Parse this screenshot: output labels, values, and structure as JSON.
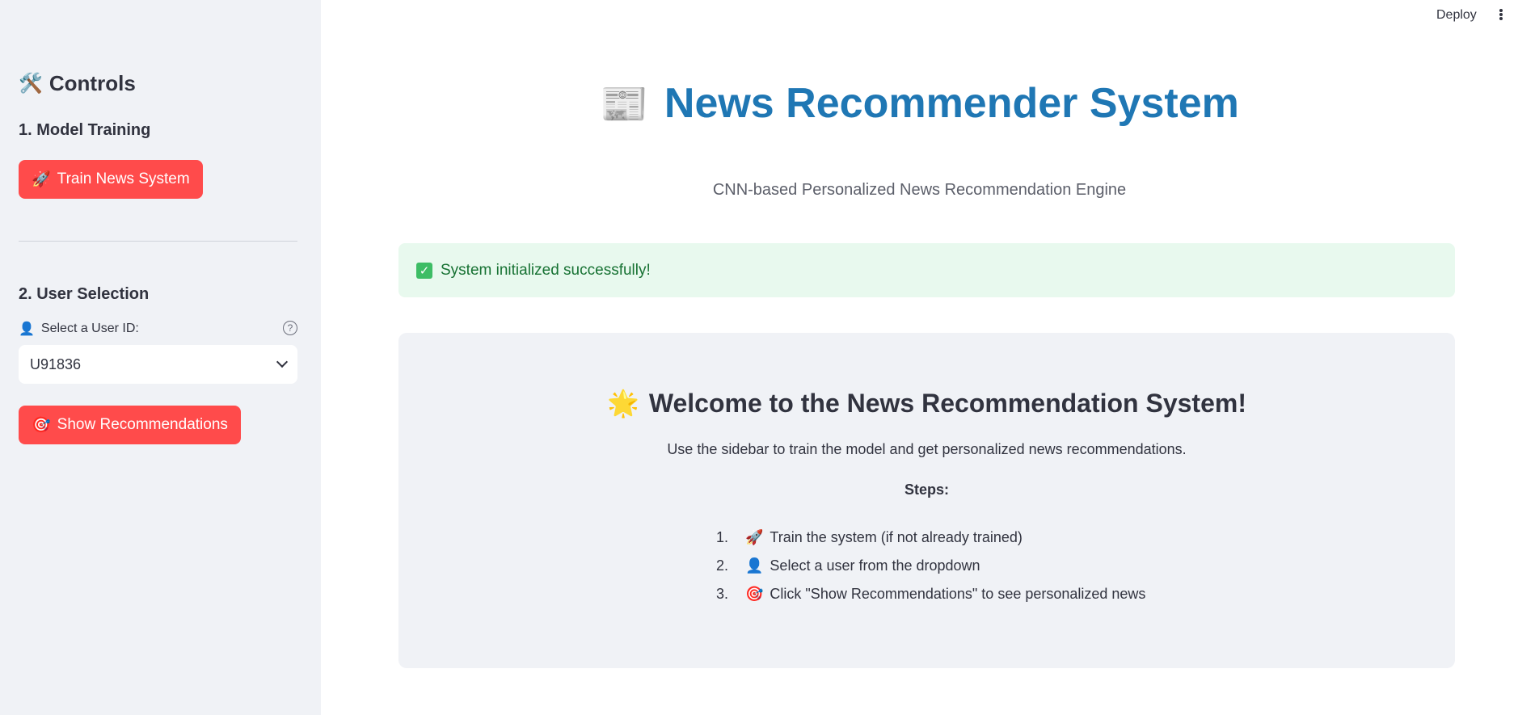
{
  "sidebar": {
    "title": "Controls",
    "title_icon": "🛠️",
    "model_training": {
      "heading": "1. Model Training",
      "button_icon": "🚀",
      "button_label": "Train News System"
    },
    "user_selection": {
      "heading": "2. User Selection",
      "select_icon": "👤",
      "select_label": "Select a User ID:",
      "help_glyph": "?",
      "selected_value": "U91836",
      "button_icon": "🎯",
      "button_label": "Show Recommendations"
    }
  },
  "topbar": {
    "deploy_label": "Deploy"
  },
  "main": {
    "title_icon": "📰",
    "title": "News Recommender System",
    "subtitle": "CNN-based Personalized News Recommendation Engine",
    "success_icon": "✓",
    "success_message": "System initialized successfully!",
    "welcome_icon": "🌟",
    "welcome_heading": "Welcome to the News Recommendation System!",
    "description": "Use the sidebar to train the model and get personalized news recommendations.",
    "steps_heading": "Steps:",
    "steps": [
      {
        "num": "1.",
        "icon": "🚀",
        "text": "Train the system (if not already trained)"
      },
      {
        "num": "2.",
        "icon": "👤",
        "text": "Select a user from the dropdown"
      },
      {
        "num": "3.",
        "icon": "🎯",
        "text": "Click \"Show Recommendations\" to see personalized news"
      }
    ]
  },
  "colors": {
    "accent_red": "#ff4b4b",
    "title_blue": "#1f77b4",
    "success_bg": "#e8f9ee",
    "success_text": "#177233",
    "sidebar_bg": "#f0f2f6"
  }
}
